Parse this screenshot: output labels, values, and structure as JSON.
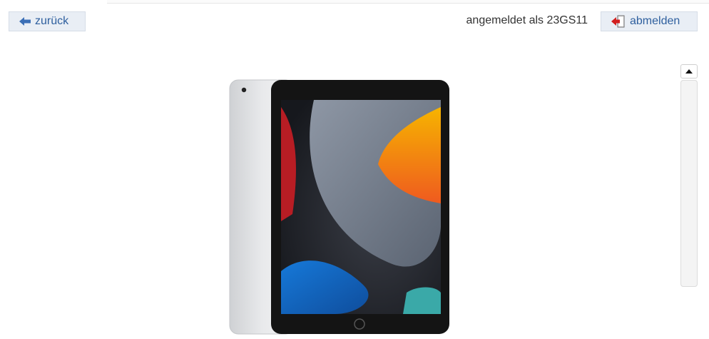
{
  "header": {
    "back_label": "zurück",
    "status_text": "angemeldet als 23GS11",
    "logout_label": "abmelden"
  },
  "icons": {
    "back": "arrow-left-icon",
    "logout": "logout-door-icon",
    "scroll_up": "triangle-up-icon"
  },
  "colors": {
    "button_bg": "#e9eef5",
    "button_text": "#2e5f9e"
  }
}
